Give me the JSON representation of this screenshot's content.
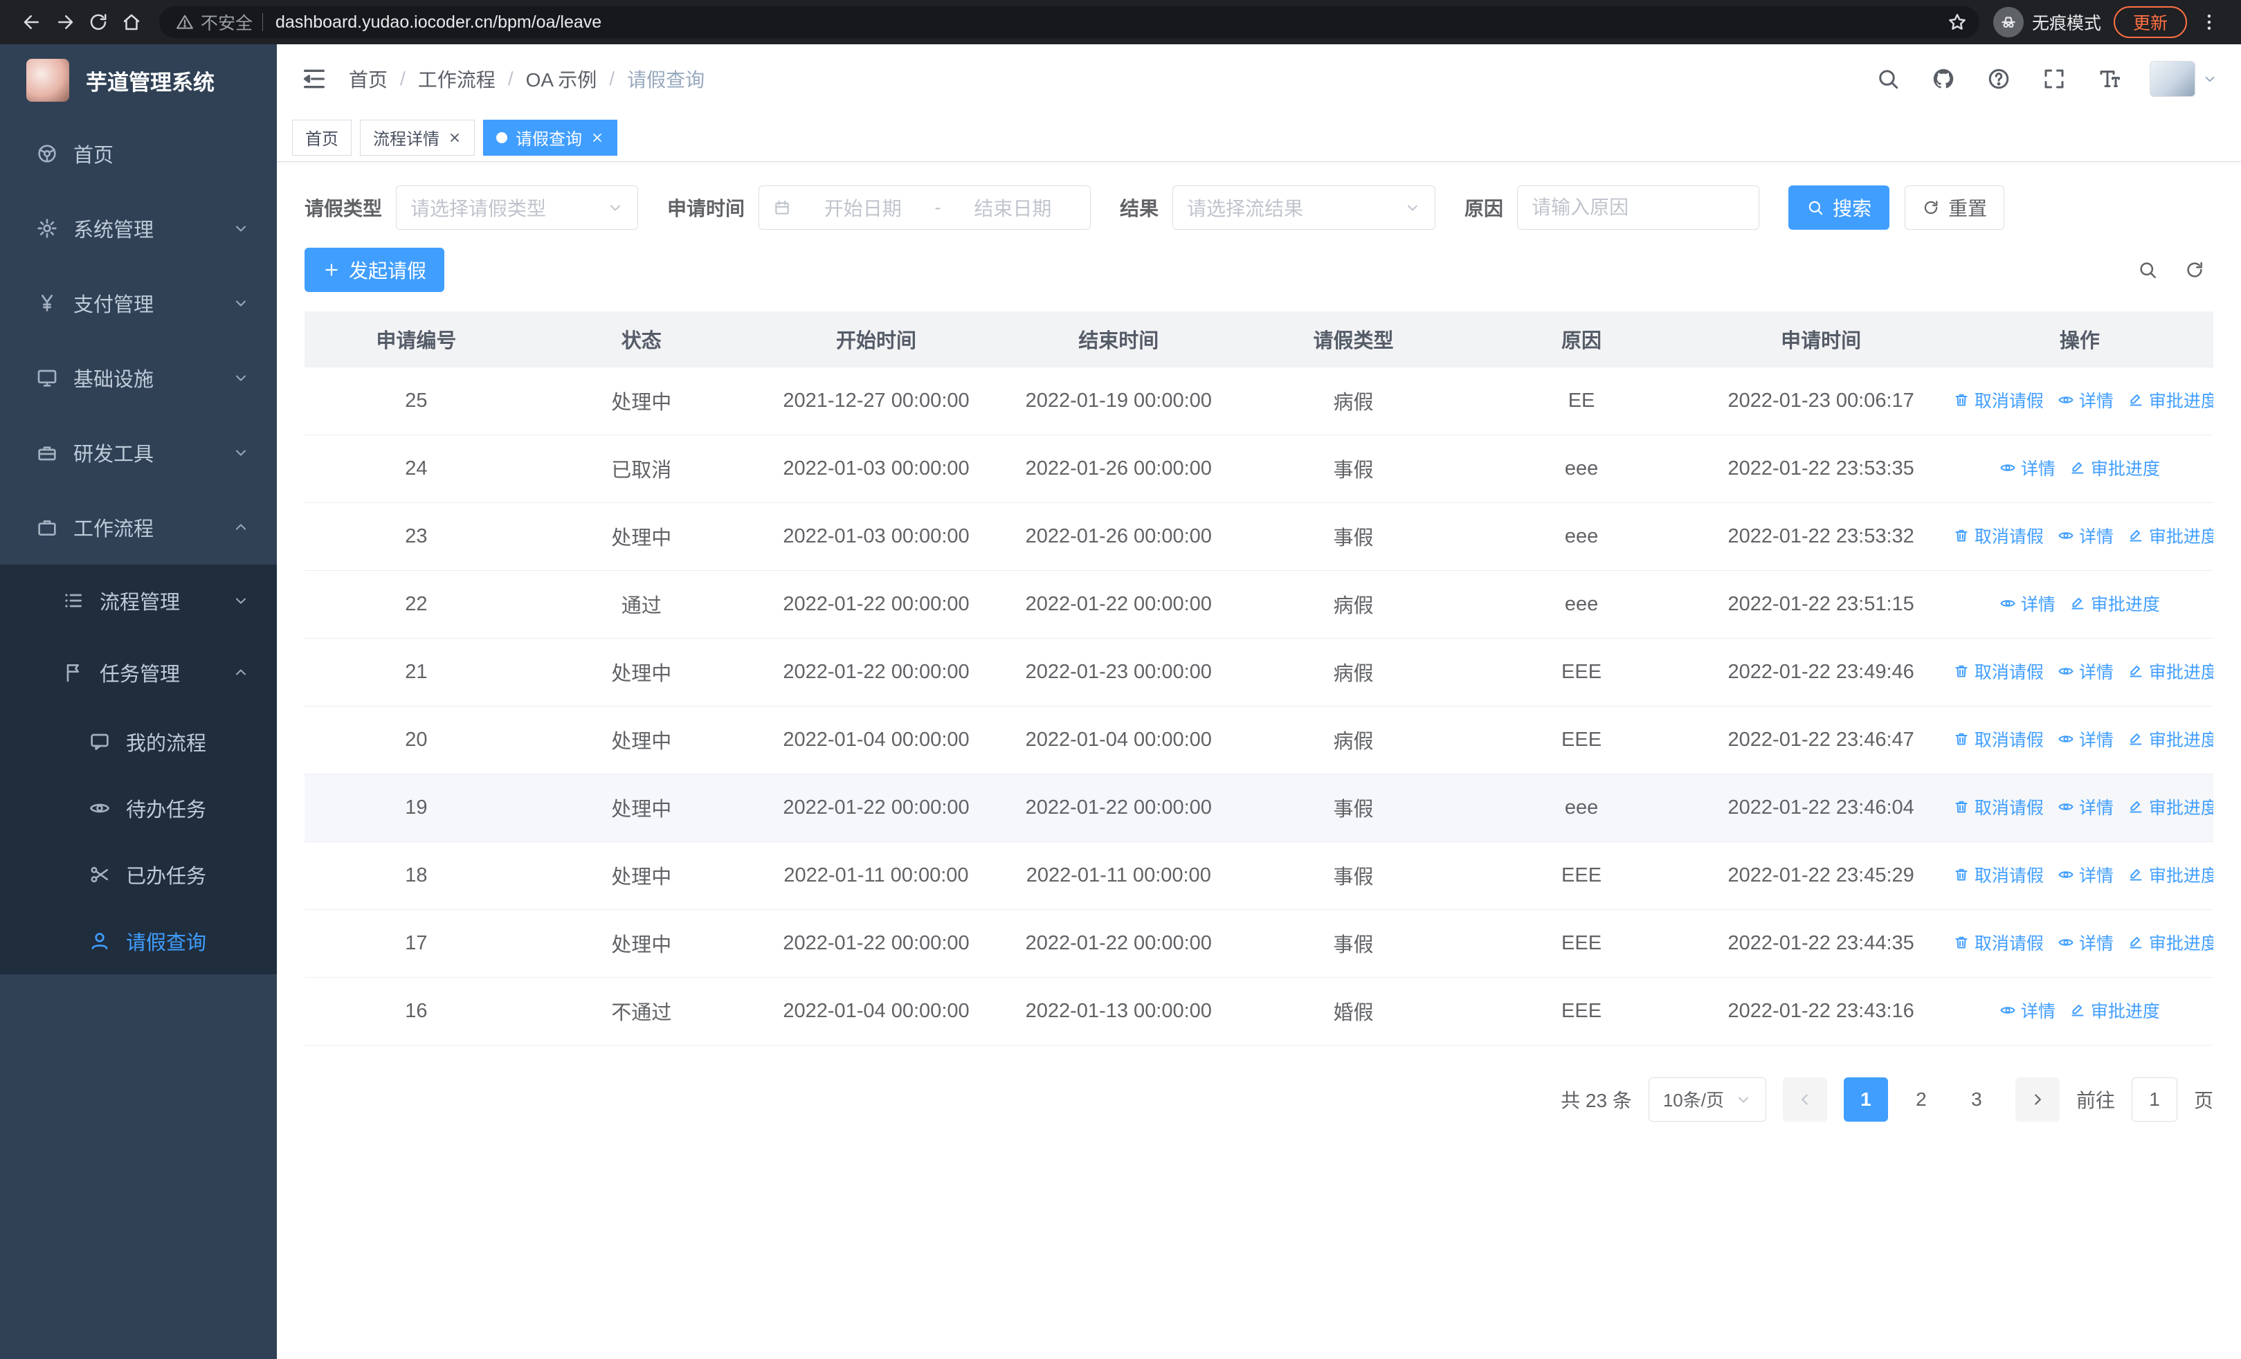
{
  "colors": {
    "primary": "#409eff",
    "sidebar_bg": "#304156",
    "sidebar_submenu_bg": "#1f2d3d",
    "browser_chrome_bg": "#202124",
    "update_button": "#ff7043",
    "table_header_bg": "#f2f3f5"
  },
  "browser": {
    "security_label": "不安全",
    "url": "dashboard.yudao.iocoder.cn/bpm/oa/leave",
    "incognito_label": "无痕模式",
    "update_label": "更新"
  },
  "sidebar": {
    "logo_title": "芋道管理系统",
    "items": [
      {
        "key": "home",
        "label": "首页",
        "icon": "dashboard-icon",
        "level": 1
      },
      {
        "key": "system",
        "label": "系统管理",
        "icon": "gear-icon",
        "level": 1,
        "arrow": "down"
      },
      {
        "key": "payment",
        "label": "支付管理",
        "icon": "yen-icon",
        "level": 1,
        "arrow": "down"
      },
      {
        "key": "infrastructure",
        "label": "基础设施",
        "icon": "monitor-icon",
        "level": 1,
        "arrow": "down"
      },
      {
        "key": "devtools",
        "label": "研发工具",
        "icon": "toolbox-icon",
        "level": 1,
        "arrow": "down"
      },
      {
        "key": "workflow",
        "label": "工作流程",
        "icon": "briefcase-icon",
        "level": 1,
        "arrow": "up",
        "expanded": true
      },
      {
        "key": "process-mgmt",
        "label": "流程管理",
        "icon": "list-icon",
        "level": 2,
        "arrow": "down"
      },
      {
        "key": "task-mgmt",
        "label": "任务管理",
        "icon": "flag-icon",
        "level": 2,
        "arrow": "up",
        "expanded": true
      },
      {
        "key": "my-process",
        "label": "我的流程",
        "icon": "message-icon",
        "level": 3
      },
      {
        "key": "todo-task",
        "label": "待办任务",
        "icon": "eye-icon",
        "level": 3
      },
      {
        "key": "done-task",
        "label": "已办任务",
        "icon": "scissors-icon",
        "level": 3
      },
      {
        "key": "leave-query",
        "label": "请假查询",
        "icon": "user-icon",
        "level": 3,
        "active": true
      }
    ]
  },
  "header": {
    "breadcrumbs": [
      "首页",
      "工作流程",
      "OA 示例",
      "请假查询"
    ],
    "breadcrumb_separator": "/",
    "icons": [
      "search-icon",
      "github-icon",
      "help-icon",
      "fullscreen-icon",
      "font-size-icon"
    ]
  },
  "tabs": [
    {
      "key": "home",
      "label": "首页",
      "closable": false,
      "active": false
    },
    {
      "key": "process-detail",
      "label": "流程详情",
      "closable": true,
      "active": false
    },
    {
      "key": "leave-query",
      "label": "请假查询",
      "closable": true,
      "active": true
    }
  ],
  "filters": {
    "leave_type": {
      "label": "请假类型",
      "placeholder": "请选择请假类型"
    },
    "apply_time": {
      "label": "申请时间",
      "start_placeholder": "开始日期",
      "separator": "-",
      "end_placeholder": "结束日期"
    },
    "result": {
      "label": "结果",
      "placeholder": "请选择流结果"
    },
    "reason": {
      "label": "原因",
      "placeholder": "请输入原因"
    },
    "search_label": "搜索",
    "reset_label": "重置"
  },
  "toolbar": {
    "create_label": "发起请假"
  },
  "table_toolbar": {
    "icons": [
      "search-icon",
      "refresh-icon"
    ]
  },
  "table": {
    "columns": [
      "申请编号",
      "状态",
      "开始时间",
      "结束时间",
      "请假类型",
      "原因",
      "申请时间",
      "操作"
    ],
    "action_labels": {
      "cancel": "取消请假",
      "detail": "详情",
      "progress": "审批进度"
    },
    "rows": [
      {
        "id": "25",
        "status": "处理中",
        "start_time": "2021-12-27 00:00:00",
        "end_time": "2022-01-19 00:00:00",
        "leave_type": "病假",
        "reason": "EE",
        "apply_time": "2022-01-23 00:06:17",
        "actions": [
          "cancel",
          "detail",
          "progress"
        ],
        "highlighted": false
      },
      {
        "id": "24",
        "status": "已取消",
        "start_time": "2022-01-03 00:00:00",
        "end_time": "2022-01-26 00:00:00",
        "leave_type": "事假",
        "reason": "eee",
        "apply_time": "2022-01-22 23:53:35",
        "actions": [
          "detail",
          "progress"
        ],
        "highlighted": false
      },
      {
        "id": "23",
        "status": "处理中",
        "start_time": "2022-01-03 00:00:00",
        "end_time": "2022-01-26 00:00:00",
        "leave_type": "事假",
        "reason": "eee",
        "apply_time": "2022-01-22 23:53:32",
        "actions": [
          "cancel",
          "detail",
          "progress"
        ],
        "highlighted": false
      },
      {
        "id": "22",
        "status": "通过",
        "start_time": "2022-01-22 00:00:00",
        "end_time": "2022-01-22 00:00:00",
        "leave_type": "病假",
        "reason": "eee",
        "apply_time": "2022-01-22 23:51:15",
        "actions": [
          "detail",
          "progress"
        ],
        "highlighted": false
      },
      {
        "id": "21",
        "status": "处理中",
        "start_time": "2022-01-22 00:00:00",
        "end_time": "2022-01-23 00:00:00",
        "leave_type": "病假",
        "reason": "EEE",
        "apply_time": "2022-01-22 23:49:46",
        "actions": [
          "cancel",
          "detail",
          "progress"
        ],
        "highlighted": false
      },
      {
        "id": "20",
        "status": "处理中",
        "start_time": "2022-01-04 00:00:00",
        "end_time": "2022-01-04 00:00:00",
        "leave_type": "病假",
        "reason": "EEE",
        "apply_time": "2022-01-22 23:46:47",
        "actions": [
          "cancel",
          "detail",
          "progress"
        ],
        "highlighted": false
      },
      {
        "id": "19",
        "status": "处理中",
        "start_time": "2022-01-22 00:00:00",
        "end_time": "2022-01-22 00:00:00",
        "leave_type": "事假",
        "reason": "eee",
        "apply_time": "2022-01-22 23:46:04",
        "actions": [
          "cancel",
          "detail",
          "progress"
        ],
        "highlighted": true
      },
      {
        "id": "18",
        "status": "处理中",
        "start_time": "2022-01-11 00:00:00",
        "end_time": "2022-01-11 00:00:00",
        "leave_type": "事假",
        "reason": "EEE",
        "apply_time": "2022-01-22 23:45:29",
        "actions": [
          "cancel",
          "detail",
          "progress"
        ],
        "highlighted": false
      },
      {
        "id": "17",
        "status": "处理中",
        "start_time": "2022-01-22 00:00:00",
        "end_time": "2022-01-22 00:00:00",
        "leave_type": "事假",
        "reason": "EEE",
        "apply_time": "2022-01-22 23:44:35",
        "actions": [
          "cancel",
          "detail",
          "progress"
        ],
        "highlighted": false
      },
      {
        "id": "16",
        "status": "不通过",
        "start_time": "2022-01-04 00:00:00",
        "end_time": "2022-01-13 00:00:00",
        "leave_type": "婚假",
        "reason": "EEE",
        "apply_time": "2022-01-22 23:43:16",
        "actions": [
          "detail",
          "progress"
        ],
        "highlighted": false
      }
    ]
  },
  "pagination": {
    "total_text": "共 23 条",
    "page_size_label": "10条/页",
    "pages": [
      "1",
      "2",
      "3"
    ],
    "active_page": "1",
    "goto_label": "前往",
    "goto_value": "1",
    "goto_suffix": "页"
  }
}
